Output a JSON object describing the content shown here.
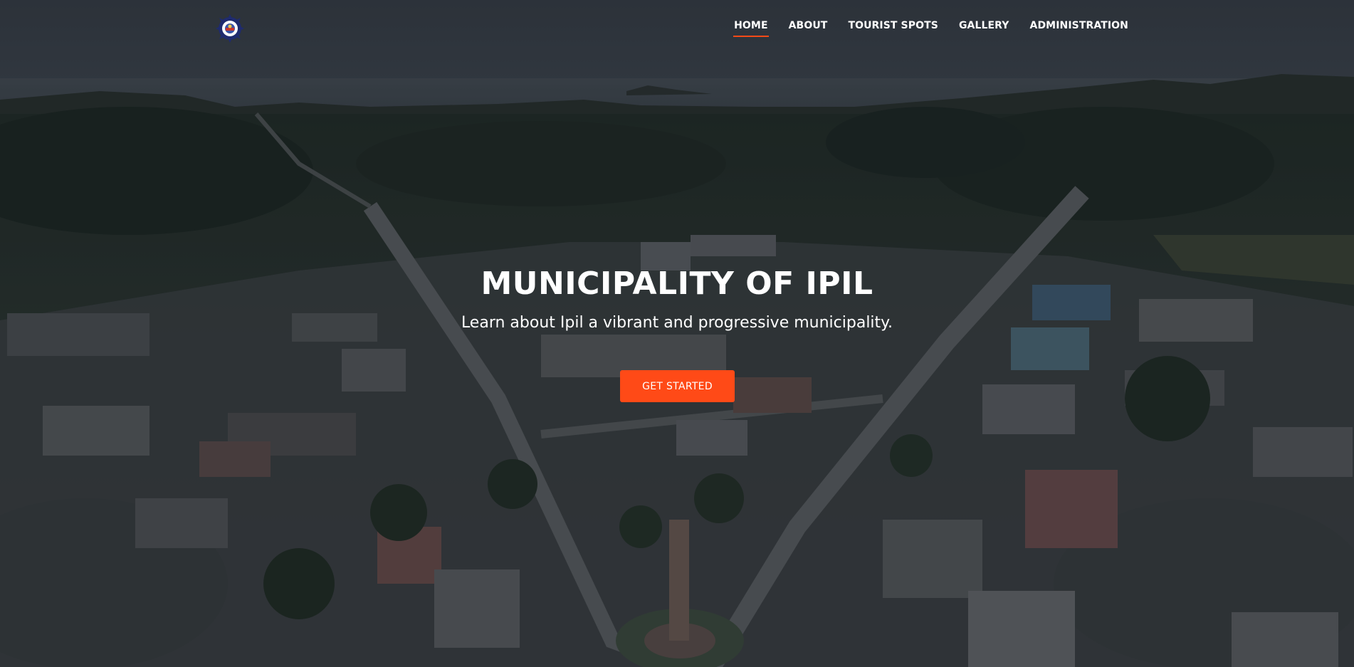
{
  "logo": {
    "icon": "municipal-seal-icon",
    "color_ring": "#1f2b6e",
    "color_center": "#ffffff"
  },
  "nav": {
    "items": [
      {
        "label": "HOME",
        "active": true
      },
      {
        "label": "ABOUT",
        "active": false
      },
      {
        "label": "TOURIST SPOTS",
        "active": false
      },
      {
        "label": "GALLERY",
        "active": false
      },
      {
        "label": "ADMINISTRATION",
        "active": false
      }
    ],
    "active_color": "#ff4a17"
  },
  "hero": {
    "title": "MUNICIPALITY OF IPIL",
    "subtitle": "Learn about Ipil a vibrant and progressive municipality.",
    "cta_label": "GET STARTED",
    "accent": "#ff4a17",
    "background": "aerial-town-photo"
  }
}
